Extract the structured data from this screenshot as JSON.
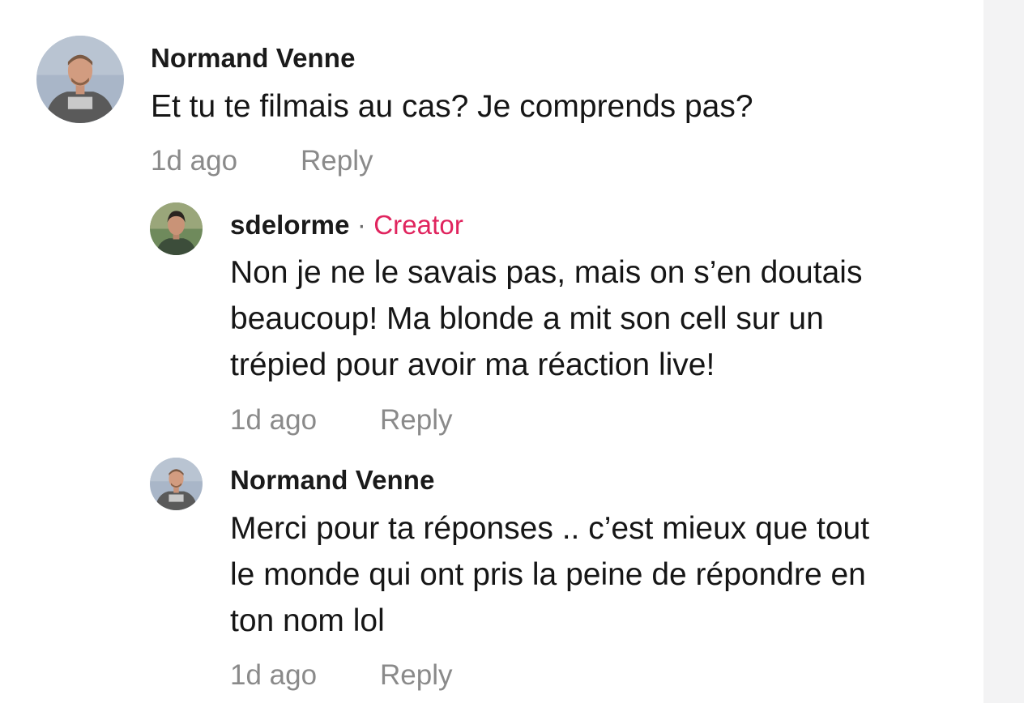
{
  "comments": [
    {
      "author": "Normand Venne",
      "is_creator": false,
      "text_lines": [
        "Et tu te filmais au cas? Je comprends pas?"
      ],
      "time": "1d ago",
      "reply_label": "Reply"
    },
    {
      "author": "sdelorme",
      "separator": "·",
      "badge": "Creator",
      "is_creator": true,
      "text_lines": [
        "Non je ne le savais pas, mais on s’en doutais",
        "beaucoup! Ma blonde a mit son cell sur un",
        "trépied pour avoir ma réaction live!"
      ],
      "time": "1d ago",
      "reply_label": "Reply"
    },
    {
      "author": "Normand Venne",
      "is_creator": false,
      "text_lines": [
        "Merci pour ta réponses .. c’est mieux que tout",
        "le monde qui ont pris la peine de répondre en",
        "ton nom lol"
      ],
      "time": "1d ago",
      "reply_label": "Reply"
    }
  ],
  "colors": {
    "creator_badge": "#e0245e",
    "meta_text": "#8a8a8a",
    "body_text": "#161616"
  }
}
